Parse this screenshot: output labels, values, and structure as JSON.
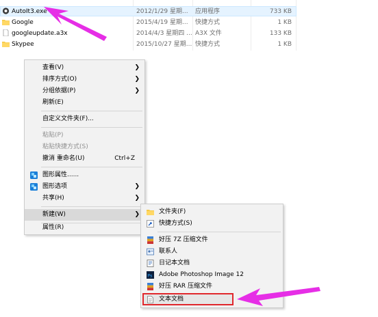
{
  "files": [
    {
      "name": "AutoIt3.exe",
      "date": "2012/1/29 星期...",
      "type": "应用程序",
      "size": "733 KB",
      "icon": "autoit-app-icon"
    },
    {
      "name": "Google",
      "date": "2015/4/19 星期...",
      "type": "快捷方式",
      "size": "1 KB",
      "icon": "folder-shortcut-icon"
    },
    {
      "name": "googleupdate.a3x",
      "date": "2014/4/3 星期四 ...",
      "type": "A3X 文件",
      "size": "133 KB",
      "icon": "file-icon"
    },
    {
      "name": "Skypee",
      "date": "2015/10/27 星期...",
      "type": "快捷方式",
      "size": "1 KB",
      "icon": "folder-shortcut-icon"
    }
  ],
  "context_menu": {
    "view": "查看(V)",
    "sort": "排序方式(O)",
    "group": "分组依据(P)",
    "refresh": "刷新(E)",
    "customize": "自定义文件夹(F)...",
    "paste": "粘贴(P)",
    "paste_shortcut": "粘贴快捷方式(S)",
    "undo_rename": "撤消 重命名(U)",
    "undo_shortcut": "Ctrl+Z",
    "graphics_props": "图形属性......",
    "graphics_options": "图形选项",
    "share": "共享(H)",
    "new": "新建(W)",
    "properties": "属性(R)"
  },
  "new_submenu": {
    "folder": "文件夹(F)",
    "shortcut": "快捷方式(S)",
    "haozip_7z": "好压 7Z 压缩文件",
    "contact": "联系人",
    "journal": "日记本文档",
    "photoshop": "Adobe Photoshop Image 12",
    "haozip_rar": "好压 RAR 压缩文件",
    "text_doc": "文本文档"
  },
  "colors": {
    "annotation_arrow": "#e62ee6",
    "highlight_box": "#e0262b"
  }
}
